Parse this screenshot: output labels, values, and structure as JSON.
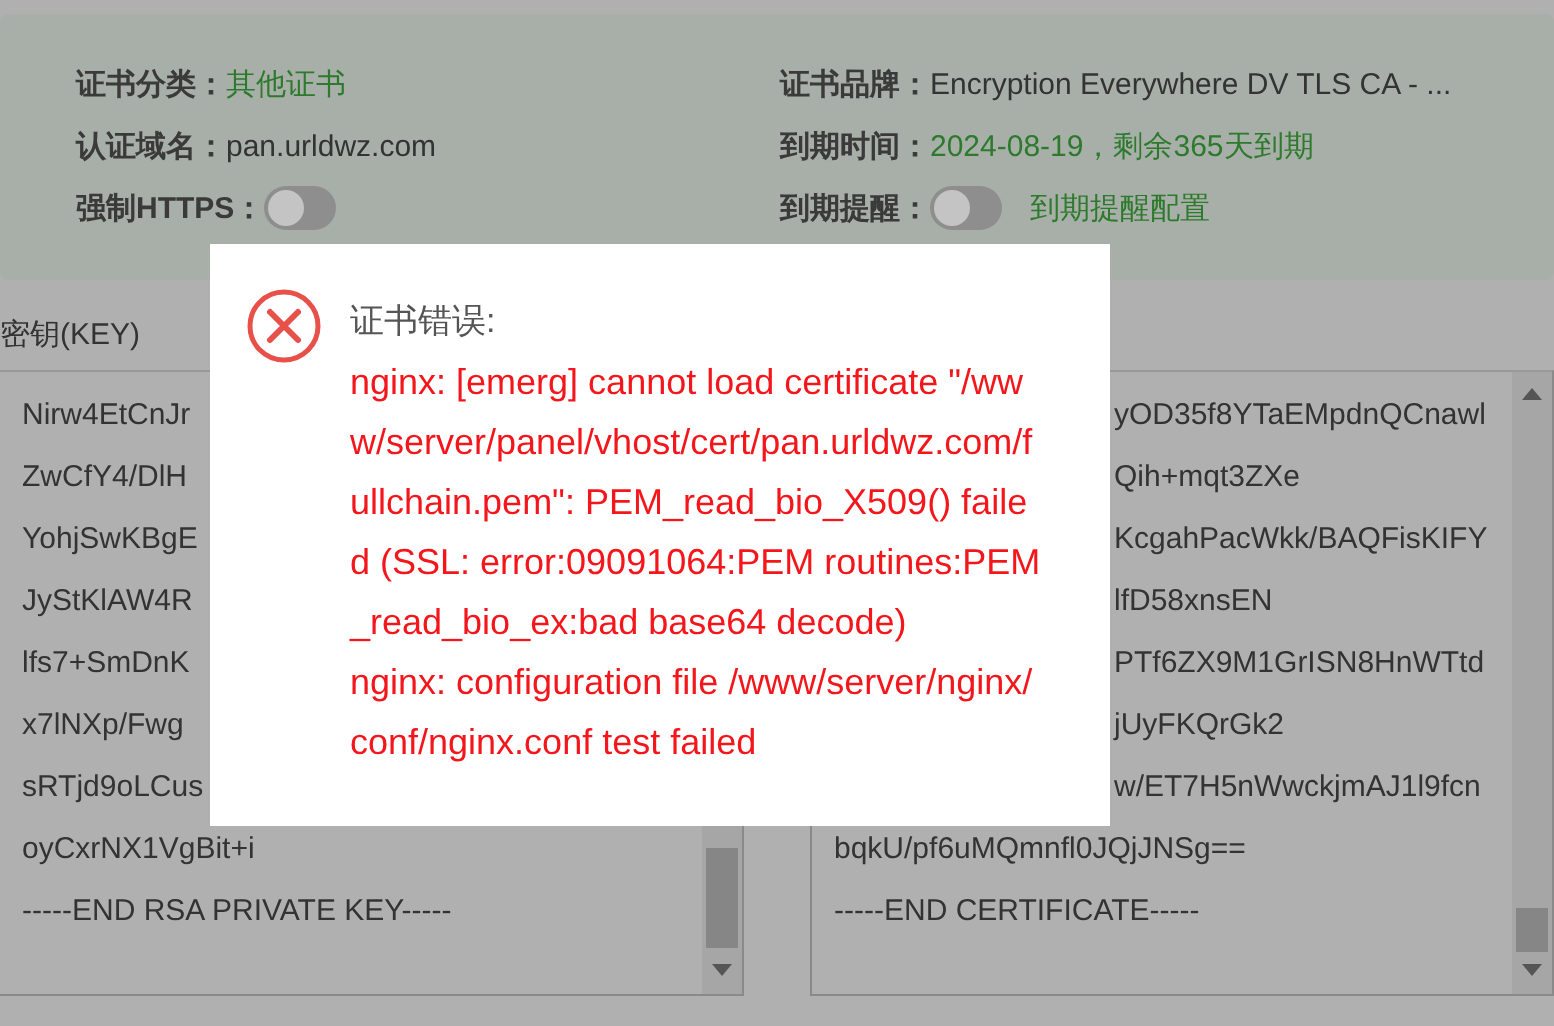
{
  "cert_info": {
    "fields": [
      {
        "label": "证书分类：",
        "kind": "highlight",
        "value": "其他证书"
      },
      {
        "label": "证书品牌：",
        "kind": "plain",
        "value": "Encryption Everywhere DV TLS CA - ..."
      },
      {
        "label": "认证域名：",
        "kind": "plain",
        "value": "pan.urldwz.com"
      },
      {
        "label": "到期时间：",
        "kind": "highlight",
        "value": "2024-08-19，剩余365天到期"
      },
      {
        "label": "强制HTTPS：",
        "kind": "toggle",
        "on": false
      },
      {
        "label": "到期提醒：",
        "kind": "toggle",
        "on": false,
        "link": "到期提醒配置"
      }
    ]
  },
  "key_box": {
    "label": "密钥(KEY)",
    "lines": [
      {
        "text": "Nirw4EtCnJr"
      },
      {
        "text": "ZwCfY4/DlH"
      },
      {
        "text": "YohjSwKBgE"
      },
      {
        "text": "JyStKlAW4R"
      },
      {
        "text": "lfs7+SmDnK"
      },
      {
        "text": "x7lNXp/Fwg"
      },
      {
        "text": "sRTjd9oLCus"
      },
      {
        "text": "oyCxrNX1VgBit+i"
      },
      {
        "text": "-----END RSA PRIVATE KEY-----"
      }
    ]
  },
  "cert_box": {
    "lines": [
      {
        "text": "yOD35f8YTaEMpdnQCnawl",
        "kind": "clipped"
      },
      {
        "text": "Qih+mqt3ZXe",
        "kind": "clipped"
      },
      {
        "text": "KcgahPacWkk/BAQFisKIFY",
        "kind": "clipped"
      },
      {
        "text": "lfD58xnsEN",
        "kind": "clipped"
      },
      {
        "text": "PTf6ZX9M1GrISN8HnWTtd",
        "kind": "clipped"
      },
      {
        "text": "jUyFKQrGk2",
        "kind": "clipped"
      },
      {
        "text": "w/ET7H5nWwckjmAJ1l9fcn",
        "kind": "clipped"
      },
      {
        "text": "bqkU/pf6uMQmnfl0JQjJNSg==",
        "kind": "full"
      },
      {
        "text": "-----END CERTIFICATE-----",
        "kind": "full"
      }
    ]
  },
  "error_dialog": {
    "title": "证书错误:",
    "messages": [
      "nginx: [emerg] cannot load certificate \"/www/server/panel/vhost/cert/pan.urldwz.com/fullchain.pem\": PEM_read_bio_X509() failed (SSL: error:09091064:PEM routines:PEM_read_bio_ex:bad base64 decode)",
      "nginx: configuration file /www/server/nginx/conf/nginx.conf test failed"
    ]
  }
}
